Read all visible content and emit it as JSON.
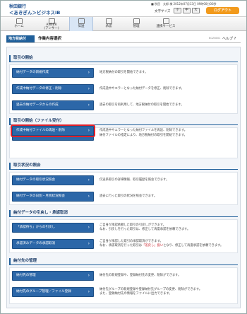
{
  "header": {
    "bank_name": "秋田銀行",
    "service_name": "＜あきぎん＞ビジネスIB",
    "user_info": "■ 秋田　太郎 様 2012年07月13日 09時00分00秒",
    "text_size_label": "文字サイズ",
    "sizes": [
      "小",
      "中",
      "大"
    ],
    "logout_label": "ログアウト"
  },
  "nav": {
    "items": [
      {
        "label": "ホーム",
        "icon": "home-icon"
      },
      {
        "label": "ANSER\n(アンサー)",
        "icon": "phone-icon"
      },
      {
        "label": "伝送",
        "icon": "transfer-icon"
      },
      {
        "label": "承認",
        "icon": "approve-icon"
      },
      {
        "label": "管理",
        "icon": "admin-icon"
      },
      {
        "label": "連携サービス",
        "icon": "link-service-icon"
      }
    ],
    "active_index": 2
  },
  "page": {
    "category": "地方税納付",
    "title": "作業内容選択",
    "screen_code": "BCZN001",
    "help_label": "ヘルプ ?"
  },
  "sections": {
    "s1": "取引の開始",
    "s2": "取引の開始（ファイル受付）",
    "s3": "取引状況の照会",
    "s4": "納付データの引戻し・承認取消",
    "s5": "納付先の管理"
  },
  "buttons": {
    "b1": "納付データの新規作成",
    "b2": "作成中納付データの修正・削除",
    "b3": "過去の納付データからの作成",
    "b4": "納付ファイルによる新規作成",
    "b5": "作成中納付ファイルの再送・削除",
    "b6": "納付データの取引状況照会",
    "b7": "納付データの日別・月別状況照会",
    "b8": "「承認待ち」からの引戻し",
    "b9": "承認済みデータの承認取消",
    "b10": "納付先の管理",
    "b11": "納付先のグループ管理／ファイル登録"
  },
  "descriptions": {
    "d1": "地方税納付の取引を開始できます。",
    "d2": "作成途中やエラーとなった納付データを修正、削除できます。",
    "d3": "過去の取引を再利用して、地方税納付の取引を開始できます。",
    "d4": "納付ファイルの指定により、地方税納付の取引を開始できます。",
    "d5": "作成途中やエラーとなった納付ファイルを再送、削除できます。",
    "d6": "伝送系取引の詳細情報、取引履歴を照会できます。",
    "d7": "過去に行った取引の状況を照会できます。",
    "d8a": "ご自身が承認依頼した取引の引戻しができます。",
    "d8b": "なお、引戻しを行った取引は、修正して再度承認を依頼できます。",
    "d9a": "ご自身が承認した取引の承認取消ができます。",
    "d9b_1": "なお、承認取消を行った取引は",
    "d9b_red": "「差戻し」扱い",
    "d9b_2": "となり、修正して再度承認を依頼できます。",
    "d10": "納付先の新規登録や、登録納付先の変更、削除ができます。",
    "d11a": "納付先グループの新規登録や登録納付先グループの変更、削除ができます。",
    "d11b": "また、登録納付先の情報をファイルに出力できます。"
  },
  "colors": {
    "primary": "#2c67a8",
    "highlight_border": "#e0202b",
    "logout": "#f29a1c"
  }
}
